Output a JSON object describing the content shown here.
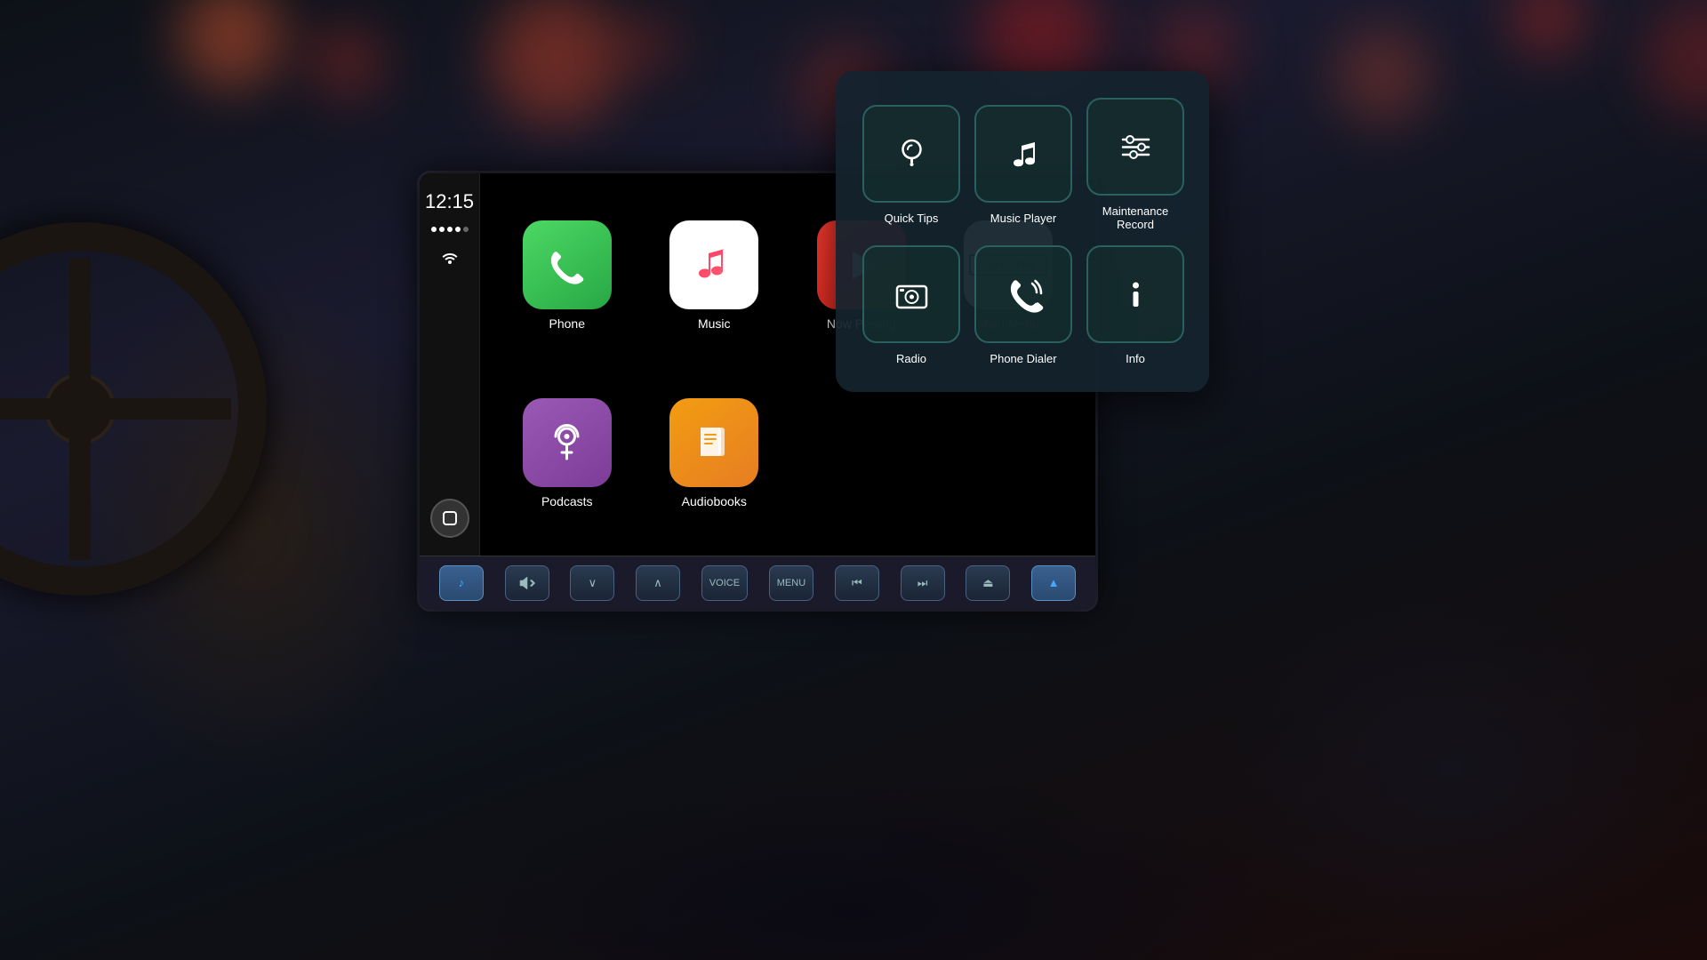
{
  "background": {
    "color": "#0d1117"
  },
  "overlay_menu": {
    "items": [
      {
        "id": "quick-tips",
        "label": "Quick Tips",
        "icon": "lightbulb",
        "unicode": "💡"
      },
      {
        "id": "music-player",
        "label": "Music Player",
        "icon": "music-note",
        "unicode": "♪"
      },
      {
        "id": "maintenance-record",
        "label": "Maintenance Record",
        "icon": "maintenance",
        "unicode": "⚙"
      },
      {
        "id": "radio",
        "label": "Radio",
        "icon": "radio",
        "unicode": "📺"
      },
      {
        "id": "phone-dialer",
        "label": "Phone Dialer",
        "icon": "phone",
        "unicode": "📞"
      },
      {
        "id": "info",
        "label": "Info",
        "icon": "info",
        "unicode": "ℹ"
      }
    ]
  },
  "car_screen": {
    "time": "12:15",
    "apps": [
      {
        "id": "phone",
        "label": "Phone",
        "type": "phone"
      },
      {
        "id": "music",
        "label": "Music",
        "type": "music"
      },
      {
        "id": "now-playing",
        "label": "Now Playing",
        "type": "now-playing"
      },
      {
        "id": "main-menu",
        "label": "Main Menu",
        "type": "main-menu"
      },
      {
        "id": "podcasts",
        "label": "Podcasts",
        "type": "podcasts"
      },
      {
        "id": "audiobooks",
        "label": "Audiobooks",
        "type": "audiobooks"
      }
    ],
    "controls": [
      {
        "id": "music-ctrl",
        "label": "♪",
        "active": true
      },
      {
        "id": "mute",
        "label": "🔇",
        "active": false
      },
      {
        "id": "down",
        "label": "∨",
        "active": false
      },
      {
        "id": "up",
        "label": "∧",
        "active": false
      },
      {
        "id": "voice",
        "label": "VOICE",
        "active": false
      },
      {
        "id": "menu",
        "label": "MENU",
        "active": false
      },
      {
        "id": "prev",
        "label": "⏮",
        "active": false
      },
      {
        "id": "next",
        "label": "⏭",
        "active": false
      },
      {
        "id": "eject",
        "label": "⏏",
        "active": false
      },
      {
        "id": "nav",
        "label": "▲",
        "active": true
      }
    ]
  }
}
